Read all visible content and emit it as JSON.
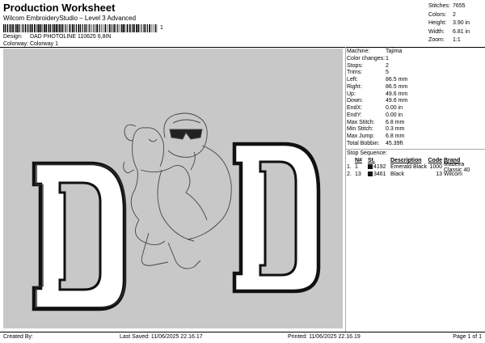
{
  "header": {
    "title": "Production Worksheet",
    "subtitle": "Wilcom EmbroideryStudio – Level 3 Advanced",
    "barcode_suffix": "1",
    "design_label": "Design:",
    "design_value": "DAD PHOTOLINE 110625 6,8IN",
    "colorway_label": "Colorway:",
    "colorway_value": "Colorway 1"
  },
  "top_stats": [
    {
      "label": "Stitches:",
      "value": "7655"
    },
    {
      "label": "Colors:",
      "value": "2"
    },
    {
      "label": "Height:",
      "value": "3.90 in"
    },
    {
      "label": "Width:",
      "value": "6.81 in"
    },
    {
      "label": "Zoom:",
      "value": "1:1"
    }
  ],
  "machine_info": [
    {
      "label": "Machine:",
      "value": "Tajima"
    },
    {
      "label": "Color changes:",
      "value": "1"
    },
    {
      "label": "Stops:",
      "value": "2"
    },
    {
      "label": "Trims:",
      "value": "5"
    },
    {
      "label": "Left:",
      "value": "86.5 mm"
    },
    {
      "label": "Right:",
      "value": "86.5 mm"
    },
    {
      "label": "Up:",
      "value": "49.6 mm"
    },
    {
      "label": "Down:",
      "value": "49.6 mm"
    },
    {
      "label": "EndX:",
      "value": "0.00 in"
    },
    {
      "label": "EndY:",
      "value": "0.00 in"
    },
    {
      "label": "Max Stitch:",
      "value": "6.8 mm"
    },
    {
      "label": "Min Stitch:",
      "value": "0.3 mm"
    },
    {
      "label": "Max Jump:",
      "value": "6.8 mm"
    },
    {
      "label": "Total Bobbin:",
      "value": "45.39ft"
    }
  ],
  "stop_sequence": {
    "title": "Stop Sequence:",
    "headers": {
      "num": "N#",
      "st": "St.",
      "desc": "Description",
      "code": "Code",
      "brand": "Brand"
    },
    "rows": [
      {
        "stop": "1.",
        "num": "1",
        "st": "4192",
        "desc": "Emerald Black",
        "code": "1000",
        "brand": "Madeira Classic 40",
        "color": "#111111"
      },
      {
        "stop": "2.",
        "num": "13",
        "st": "3461",
        "desc": "Black",
        "code": "13",
        "brand": "Wilcom",
        "color": "#111111"
      }
    ]
  },
  "footer": {
    "created_by": "Created By:",
    "last_saved": "Last Saved: 11/06/2025 22.16.17",
    "printed": "Printed: 11/06/2025 22.16.19",
    "page": "Page 1 of 1"
  },
  "colors": {
    "canvas_bg": "#c8c8c8",
    "thread_black": "#111111",
    "outline": "#333333"
  }
}
